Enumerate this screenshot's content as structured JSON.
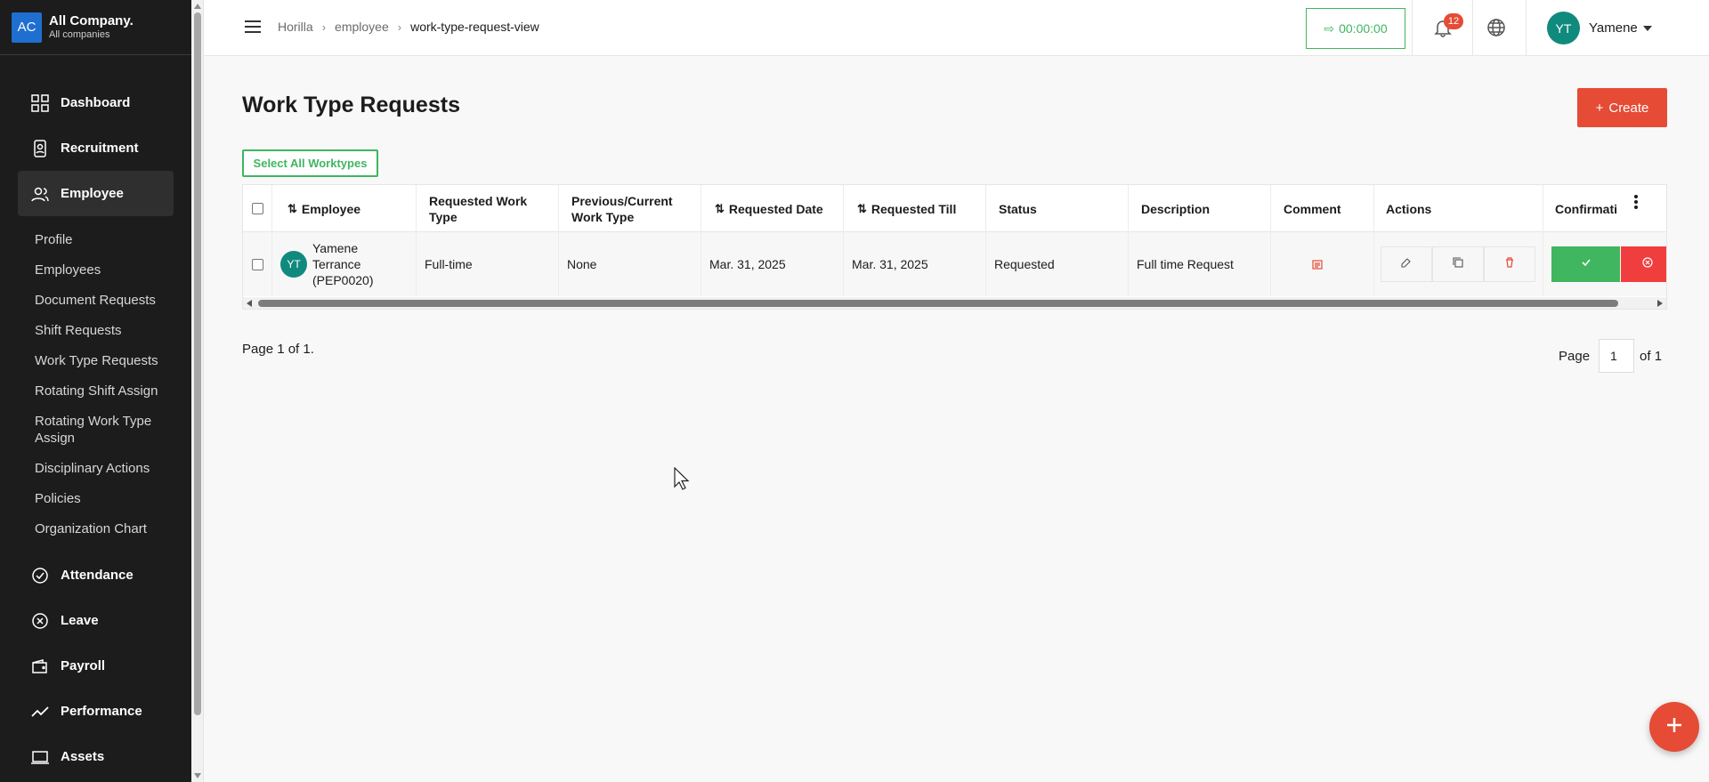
{
  "company": {
    "logo": "AC",
    "name": "All Company.",
    "sub": "All companies"
  },
  "sidebar": {
    "main_top": [
      {
        "label": "Dashboard",
        "icon": "dashboard-icon"
      },
      {
        "label": "Recruitment",
        "icon": "recruitment-icon"
      },
      {
        "label": "Employee",
        "icon": "employee-icon",
        "active": true
      }
    ],
    "sub_items": [
      "Profile",
      "Employees",
      "Document Requests",
      "Shift Requests",
      "Work Type Requests",
      "Rotating Shift Assign",
      "Rotating Work Type Assign",
      "Disciplinary Actions",
      "Policies",
      "Organization Chart"
    ],
    "main_bottom": [
      {
        "label": "Attendance",
        "icon": "attendance-icon"
      },
      {
        "label": "Leave",
        "icon": "leave-icon"
      },
      {
        "label": "Payroll",
        "icon": "payroll-icon"
      },
      {
        "label": "Performance",
        "icon": "performance-icon"
      },
      {
        "label": "Assets",
        "icon": "assets-icon"
      }
    ]
  },
  "topbar": {
    "breadcrumb": [
      "Horilla",
      "employee",
      "work-type-request-view"
    ],
    "timer": "00:00:00",
    "notifications": "12",
    "user": {
      "initials": "YT",
      "name": "Yamene"
    }
  },
  "main": {
    "title": "Work Type Requests",
    "create_label": "Create",
    "select_all_label": "Select All Worktypes"
  },
  "table": {
    "headers": {
      "employee": "Employee",
      "requested_work_type": "Requested Work Type",
      "previous_work_type": "Previous/Current Work Type",
      "requested_date": "Requested Date",
      "requested_till": "Requested Till",
      "status": "Status",
      "description": "Description",
      "comment": "Comment",
      "actions": "Actions",
      "confirmation": "Confirmati"
    },
    "rows": [
      {
        "initials": "YT",
        "employee": "Yamene Terrance (PEP0020)",
        "requested_work_type": "Full-time",
        "previous_work_type": "None",
        "requested_date": "Mar. 31, 2025",
        "requested_till": "Mar. 31, 2025",
        "status": "Requested",
        "description": "Full time Request"
      }
    ]
  },
  "pagination": {
    "left": "Page 1 of 1.",
    "page_label": "Page",
    "page_value": "1",
    "of_label": "of 1"
  },
  "colors": {
    "accent": "#e54b35",
    "success": "#3fb65f",
    "danger": "#f03e3e",
    "sidebar": "#1c1c1c",
    "avatar": "#118a7e"
  }
}
